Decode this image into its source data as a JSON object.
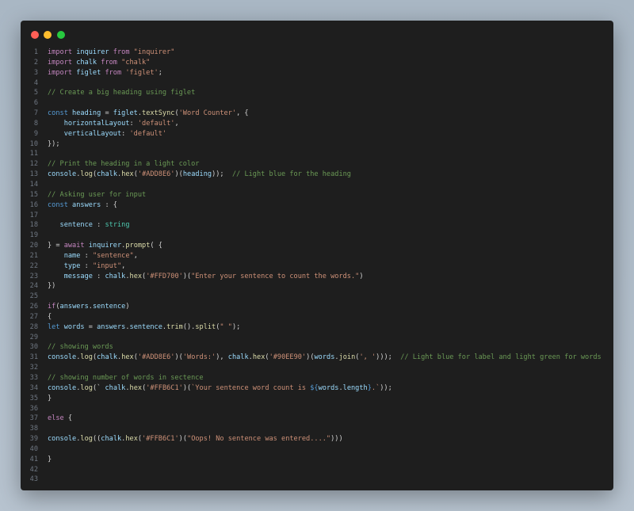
{
  "window": {
    "dots": [
      {
        "name": "close",
        "color": "#ff5f56"
      },
      {
        "name": "minimize",
        "color": "#ffbd2e"
      },
      {
        "name": "maximize",
        "color": "#27c93f"
      }
    ]
  },
  "code": {
    "lines": [
      [
        [
          "kw",
          "import "
        ],
        [
          "id",
          "inquirer"
        ],
        [
          "kw",
          " from "
        ],
        [
          "str",
          "\"inquirer\""
        ]
      ],
      [
        [
          "kw",
          "import "
        ],
        [
          "id",
          "chalk"
        ],
        [
          "kw",
          " from "
        ],
        [
          "str",
          "\"chalk\""
        ]
      ],
      [
        [
          "kw",
          "import "
        ],
        [
          "id",
          "figlet"
        ],
        [
          "kw",
          " from "
        ],
        [
          "str",
          "'figlet'"
        ],
        [
          "pl",
          ";"
        ]
      ],
      [],
      [
        [
          "cm",
          "// Create a big heading using figlet"
        ]
      ],
      [],
      [
        [
          "dk",
          "const "
        ],
        [
          "id",
          "heading"
        ],
        [
          "pl",
          " = "
        ],
        [
          "id",
          "figlet"
        ],
        [
          "pl",
          "."
        ],
        [
          "fn",
          "textSync"
        ],
        [
          "pl",
          "("
        ],
        [
          "str",
          "'Word Counter'"
        ],
        [
          "pl",
          ", {"
        ]
      ],
      [
        [
          "pl",
          "    "
        ],
        [
          "id",
          "horizontalLayout"
        ],
        [
          "pl",
          ": "
        ],
        [
          "str",
          "'default'"
        ],
        [
          "pl",
          ","
        ]
      ],
      [
        [
          "pl",
          "    "
        ],
        [
          "id",
          "verticalLayout"
        ],
        [
          "pl",
          ": "
        ],
        [
          "str",
          "'default'"
        ]
      ],
      [
        [
          "pl",
          "});"
        ]
      ],
      [],
      [
        [
          "cm",
          "// Print the heading in a light color"
        ]
      ],
      [
        [
          "id",
          "console"
        ],
        [
          "pl",
          "."
        ],
        [
          "fn",
          "log"
        ],
        [
          "pl",
          "("
        ],
        [
          "id",
          "chalk"
        ],
        [
          "pl",
          "."
        ],
        [
          "fn",
          "hex"
        ],
        [
          "pl",
          "("
        ],
        [
          "str",
          "'#ADD8E6'"
        ],
        [
          "pl",
          ")("
        ],
        [
          "id",
          "heading"
        ],
        [
          "pl",
          "));  "
        ],
        [
          "cm",
          "// Light blue for the heading"
        ]
      ],
      [],
      [
        [
          "cm",
          "// Asking user for input"
        ]
      ],
      [
        [
          "dk",
          "const "
        ],
        [
          "id",
          "answers"
        ],
        [
          "pl",
          " : {"
        ]
      ],
      [],
      [
        [
          "pl",
          "   "
        ],
        [
          "id",
          "sentence"
        ],
        [
          "pl",
          " : "
        ],
        [
          "ty",
          "string"
        ]
      ],
      [],
      [
        [
          "pl",
          "} = "
        ],
        [
          "kw",
          "await "
        ],
        [
          "id",
          "inquirer"
        ],
        [
          "pl",
          "."
        ],
        [
          "fn",
          "prompt"
        ],
        [
          "pl",
          "( {"
        ]
      ],
      [
        [
          "pl",
          "    "
        ],
        [
          "id",
          "name"
        ],
        [
          "pl",
          " : "
        ],
        [
          "str",
          "\"sentence\""
        ],
        [
          "pl",
          ","
        ]
      ],
      [
        [
          "pl",
          "    "
        ],
        [
          "id",
          "type"
        ],
        [
          "pl",
          " : "
        ],
        [
          "str",
          "\"input\""
        ],
        [
          "pl",
          ","
        ]
      ],
      [
        [
          "pl",
          "    "
        ],
        [
          "id",
          "message"
        ],
        [
          "pl",
          " : "
        ],
        [
          "id",
          "chalk"
        ],
        [
          "pl",
          "."
        ],
        [
          "fn",
          "hex"
        ],
        [
          "pl",
          "("
        ],
        [
          "str",
          "'#FFD700'"
        ],
        [
          "pl",
          ")("
        ],
        [
          "str",
          "\"Enter your sentence to count the words.\""
        ],
        [
          "pl",
          ")"
        ]
      ],
      [
        [
          "pl",
          "})"
        ]
      ],
      [],
      [
        [
          "kw",
          "if"
        ],
        [
          "pl",
          "("
        ],
        [
          "id",
          "answers"
        ],
        [
          "pl",
          "."
        ],
        [
          "id",
          "sentence"
        ],
        [
          "pl",
          ")"
        ]
      ],
      [
        [
          "pl",
          "{"
        ]
      ],
      [
        [
          "dk",
          "let "
        ],
        [
          "id",
          "words"
        ],
        [
          "pl",
          " = "
        ],
        [
          "id",
          "answers"
        ],
        [
          "pl",
          "."
        ],
        [
          "id",
          "sentence"
        ],
        [
          "pl",
          "."
        ],
        [
          "fn",
          "trim"
        ],
        [
          "pl",
          "()."
        ],
        [
          "fn",
          "split"
        ],
        [
          "pl",
          "("
        ],
        [
          "str",
          "\" \""
        ],
        [
          "pl",
          ");"
        ]
      ],
      [],
      [
        [
          "cm",
          "// showing words"
        ]
      ],
      [
        [
          "id",
          "console"
        ],
        [
          "pl",
          "."
        ],
        [
          "fn",
          "log"
        ],
        [
          "pl",
          "("
        ],
        [
          "id",
          "chalk"
        ],
        [
          "pl",
          "."
        ],
        [
          "fn",
          "hex"
        ],
        [
          "pl",
          "("
        ],
        [
          "str",
          "'#ADD8E6'"
        ],
        [
          "pl",
          ")("
        ],
        [
          "str",
          "'Words:'"
        ],
        [
          "pl",
          "), "
        ],
        [
          "id",
          "chalk"
        ],
        [
          "pl",
          "."
        ],
        [
          "fn",
          "hex"
        ],
        [
          "pl",
          "("
        ],
        [
          "str",
          "'#90EE90'"
        ],
        [
          "pl",
          ")("
        ],
        [
          "id",
          "words"
        ],
        [
          "pl",
          "."
        ],
        [
          "fn",
          "join"
        ],
        [
          "pl",
          "("
        ],
        [
          "str",
          "', '"
        ],
        [
          "pl",
          ")));  "
        ],
        [
          "cm",
          "// Light blue for label and light green for words"
        ]
      ],
      [],
      [
        [
          "cm",
          "// showing number of words in sectence"
        ]
      ],
      [
        [
          "id",
          "console"
        ],
        [
          "pl",
          "."
        ],
        [
          "fn",
          "log"
        ],
        [
          "pl",
          "(` "
        ],
        [
          "id",
          "chalk"
        ],
        [
          "pl",
          "."
        ],
        [
          "fn",
          "hex"
        ],
        [
          "pl",
          "("
        ],
        [
          "str",
          "'#FFB6C1'"
        ],
        [
          "pl",
          ")("
        ],
        [
          "str",
          "`Your sentence word count is "
        ],
        [
          "dk",
          "${"
        ],
        [
          "id",
          "words"
        ],
        [
          "pl",
          "."
        ],
        [
          "id",
          "length"
        ],
        [
          "dk",
          "}"
        ],
        [
          "str",
          ".`"
        ],
        [
          "pl",
          "));"
        ]
      ],
      [
        [
          "pl",
          "}"
        ]
      ],
      [],
      [
        [
          "kw",
          "else "
        ],
        [
          "pl",
          "{"
        ]
      ],
      [],
      [
        [
          "id",
          "console"
        ],
        [
          "pl",
          "."
        ],
        [
          "fn",
          "log"
        ],
        [
          "pl",
          "(("
        ],
        [
          "id",
          "chalk"
        ],
        [
          "pl",
          "."
        ],
        [
          "fn",
          "hex"
        ],
        [
          "pl",
          "("
        ],
        [
          "str",
          "'#FFB6C1'"
        ],
        [
          "pl",
          ")("
        ],
        [
          "str",
          "\"Oops! No sentence was entered....\""
        ],
        [
          "pl",
          ")))"
        ]
      ],
      [],
      [
        [
          "pl",
          "}"
        ]
      ],
      [],
      []
    ]
  }
}
